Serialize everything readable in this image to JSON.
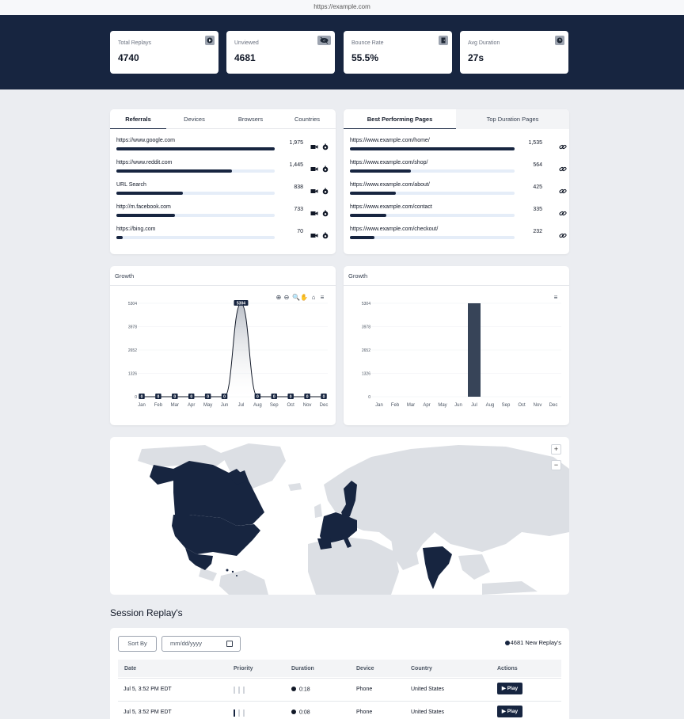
{
  "url": "https://example.com",
  "stats": [
    {
      "label": "Total Replays",
      "value": "4740",
      "icon": "play-circle-icon"
    },
    {
      "label": "Unviewed",
      "value": "4681",
      "icon": "eye-slash-icon"
    },
    {
      "label": "Bounce Rate",
      "value": "55.5%",
      "icon": "door-exit-icon"
    },
    {
      "label": "Avg Duration",
      "value": "27s",
      "icon": "clock-icon"
    }
  ],
  "referrals": {
    "tabs": [
      "Referrals",
      "Devices",
      "Browsers",
      "Countries"
    ],
    "active_tab": "Referrals",
    "rows": [
      {
        "name": "https://www.google.com",
        "value": "1,975",
        "fraction": 1.0
      },
      {
        "name": "https://www.reddit.com",
        "value": "1,445",
        "fraction": 0.73
      },
      {
        "name": "URL Search",
        "value": "838",
        "fraction": 0.42
      },
      {
        "name": "http://m.facebook.com",
        "value": "733",
        "fraction": 0.37
      },
      {
        "name": "https://bing.com",
        "value": "70",
        "fraction": 0.04
      }
    ]
  },
  "pages": {
    "tabs": [
      "Best Performing Pages",
      "Top Duration Pages"
    ],
    "active_tab": "Best Performing Pages",
    "rows": [
      {
        "name": "https://www.example.com/home/",
        "value": "1,535",
        "fraction": 1.0
      },
      {
        "name": "https://www.example.com/shop/",
        "value": "564",
        "fraction": 0.37
      },
      {
        "name": "https://www.example.com/about/",
        "value": "425",
        "fraction": 0.28
      },
      {
        "name": "https://www.example.com/contact",
        "value": "335",
        "fraction": 0.22
      },
      {
        "name": "https://www.example.com/checkout/",
        "value": "232",
        "fraction": 0.15
      }
    ]
  },
  "growth_left": {
    "title": "Growth"
  },
  "growth_right": {
    "title": "Growth"
  },
  "chart_data": [
    {
      "type": "area",
      "title": "Growth",
      "categories": [
        "Jan",
        "Feb",
        "Mar",
        "Apr",
        "May",
        "Jun",
        "Jul",
        "Aug",
        "Sep",
        "Oct",
        "Nov",
        "Dec"
      ],
      "values": [
        0,
        0,
        0,
        0,
        0,
        0,
        5304,
        0,
        0,
        0,
        0,
        0
      ],
      "yticks": [
        "0",
        "1326",
        "2652",
        "3978",
        "5304"
      ],
      "ylim": [
        0,
        5304
      ],
      "data_labels": [
        "0",
        "0",
        "0",
        "0",
        "0",
        "0",
        "5304",
        "0",
        "0",
        "0",
        "0",
        "0"
      ]
    },
    {
      "type": "bar",
      "title": "Growth",
      "categories": [
        "Jan",
        "Feb",
        "Mar",
        "Apr",
        "May",
        "Jun",
        "Jul",
        "Aug",
        "Sep",
        "Oct",
        "Nov",
        "Dec"
      ],
      "values": [
        0,
        0,
        0,
        0,
        0,
        0,
        5304,
        0,
        0,
        0,
        0,
        0
      ],
      "yticks": [
        "0",
        "1326",
        "2652",
        "3978",
        "5304"
      ],
      "ylim": [
        0,
        5304
      ]
    }
  ],
  "map": {
    "zoom_in": "+",
    "zoom_out": "−"
  },
  "session": {
    "title": "Session Replay's",
    "sort_label": "Sort By",
    "date_placeholder": "mm/dd/yyyy",
    "new_count": "4681 New Replay's",
    "columns": [
      "Date",
      "Priority",
      "Duration",
      "Device",
      "Country",
      "Actions"
    ],
    "rows": [
      {
        "date": "Jul 5, 3:52 PM EDT",
        "priority": 0,
        "duration": "0:18",
        "device": "Phone",
        "country": "United States",
        "action": "▶ Play"
      },
      {
        "date": "Jul 5, 3:52 PM EDT",
        "priority": 1,
        "duration": "0:08",
        "device": "Phone",
        "country": "United States",
        "action": "▶ Play"
      }
    ]
  },
  "colors": {
    "navy": "#172540",
    "track": "#e5edf8",
    "bg": "#ebedf1"
  }
}
